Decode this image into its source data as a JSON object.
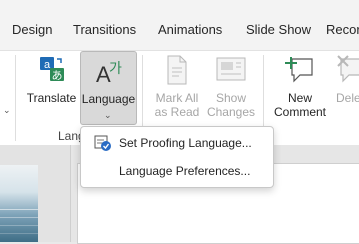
{
  "tabs": [
    "Design",
    "Transitions",
    "Animations",
    "Slide Show",
    "Recor"
  ],
  "ribbon": {
    "translate_label": "Translate",
    "language_label": "Language",
    "language_group_label": "Lang",
    "mark_all_read_line1": "Mark All",
    "mark_all_read_line2": "as Read",
    "show_changes_line1": "Show",
    "show_changes_line2": "Changes",
    "new_comment_line1": "New",
    "new_comment_line2": "Comment",
    "delete_partial": "Dele"
  },
  "language_menu": {
    "items": [
      {
        "label": "Set Proofing Language...",
        "icon": "proofing-language-icon"
      },
      {
        "label": "Language Preferences..."
      }
    ]
  },
  "colors": {
    "accent_green": "#2e8b57",
    "translate_blue": "#1f6bb5",
    "menu_icon_blue": "#2b6cc4"
  }
}
